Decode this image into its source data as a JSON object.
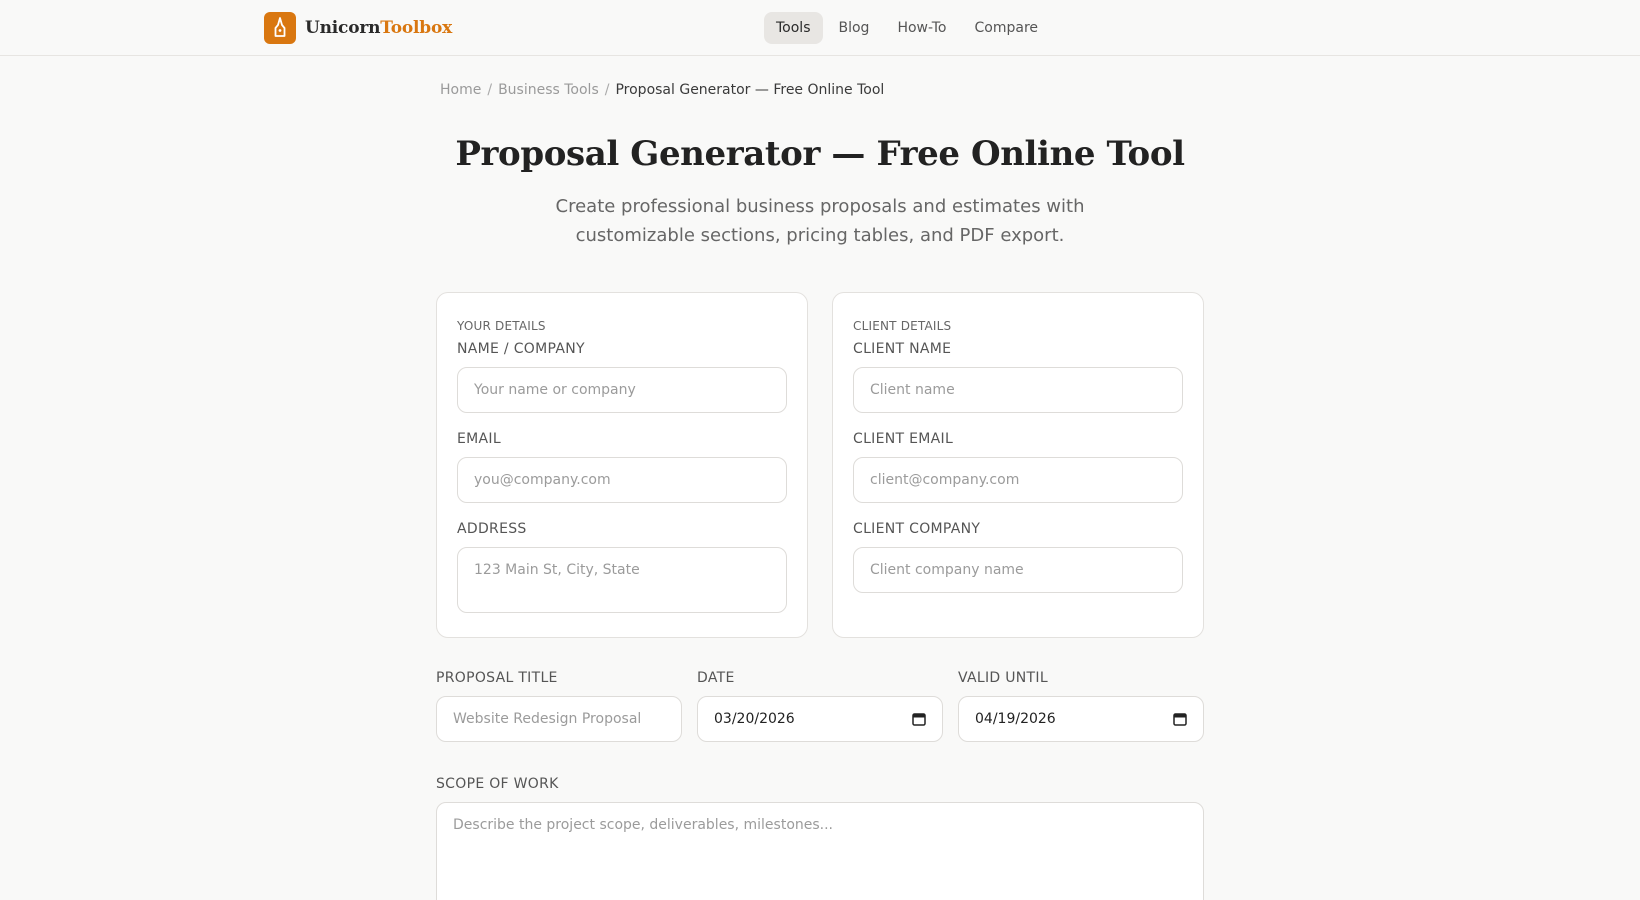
{
  "brand": {
    "name_part1": "Unicorn",
    "name_part2": "Toolbox"
  },
  "nav": {
    "items": [
      {
        "label": "Tools",
        "active": true
      },
      {
        "label": "Blog"
      },
      {
        "label": "How-To"
      },
      {
        "label": "Compare"
      }
    ]
  },
  "breadcrumb": {
    "home": "Home",
    "section": "Business Tools",
    "current": "Proposal Generator — Free Online Tool",
    "separator": "/"
  },
  "page": {
    "title": "Proposal Generator — Free Online Tool",
    "subtitle": "Create professional business proposals and estimates with customizable sections, pricing tables, and PDF export."
  },
  "your_details": {
    "heading": "YOUR DETAILS",
    "name_label": "NAME / COMPANY",
    "name_placeholder": "Your name or company",
    "email_label": "EMAIL",
    "email_placeholder": "you@company.com",
    "address_label": "ADDRESS",
    "address_placeholder": "123 Main St, City, State"
  },
  "client_details": {
    "heading": "CLIENT DETAILS",
    "name_label": "CLIENT NAME",
    "name_placeholder": "Client name",
    "email_label": "CLIENT EMAIL",
    "email_placeholder": "client@company.com",
    "company_label": "CLIENT COMPANY",
    "company_placeholder": "Client company name"
  },
  "proposal": {
    "title_label": "PROPOSAL TITLE",
    "title_placeholder": "Website Redesign Proposal",
    "date_label": "DATE",
    "date_value": "03/20/2026",
    "valid_label": "VALID UNTIL",
    "valid_value": "04/19/2026"
  },
  "scope": {
    "label": "SCOPE OF WORK",
    "placeholder": "Describe the project scope, deliverables, milestones..."
  },
  "colors": {
    "accent": "#d97710",
    "background": "#f9f9f8",
    "card": "#ffffff"
  },
  "icons": {
    "logo": "pen-nib-icon",
    "calendar": "calendar-icon"
  }
}
